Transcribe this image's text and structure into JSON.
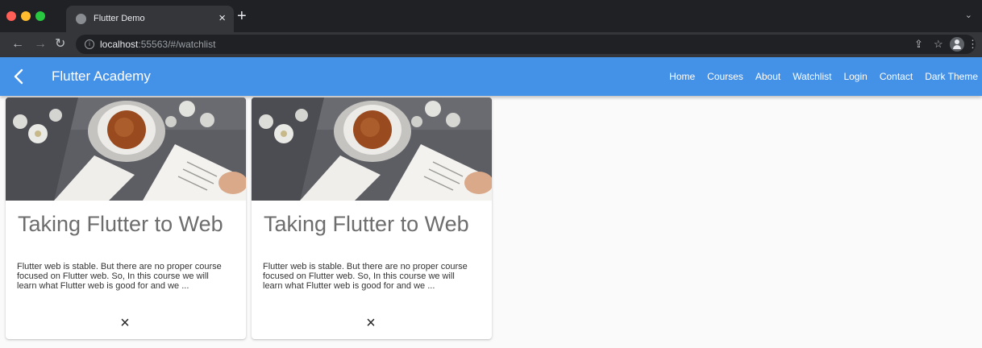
{
  "browser": {
    "tab_title": "Flutter Demo",
    "tab_close": "×",
    "new_tab": "+",
    "tab_menu": "⌄",
    "url_host": "localhost",
    "url_rest": ":55563/#/watchlist",
    "colors": {
      "close": "#ff5f57",
      "minimize": "#febc2e",
      "zoom": "#28c840"
    }
  },
  "appbar": {
    "title": "Flutter Academy",
    "color": "#4491e8",
    "nav": [
      "Home",
      "Courses",
      "About",
      "Watchlist",
      "Login",
      "Contact",
      "Dark Theme"
    ]
  },
  "courses": [
    {
      "title": "Taking Flutter to Web",
      "description": "Flutter web is stable. But there are no proper course focused on Flutter web. So, In this course we will learn what Flutter web is good for and we ...",
      "image": "coffee-cup-and-books-photo",
      "remove_icon": "×"
    },
    {
      "title": "Taking Flutter to Web",
      "description": "Flutter web is stable. But there are no proper course focused on Flutter web. So, In this course we will learn what Flutter web is good for and we ...",
      "image": "coffee-cup-and-books-photo",
      "remove_icon": "×"
    }
  ]
}
